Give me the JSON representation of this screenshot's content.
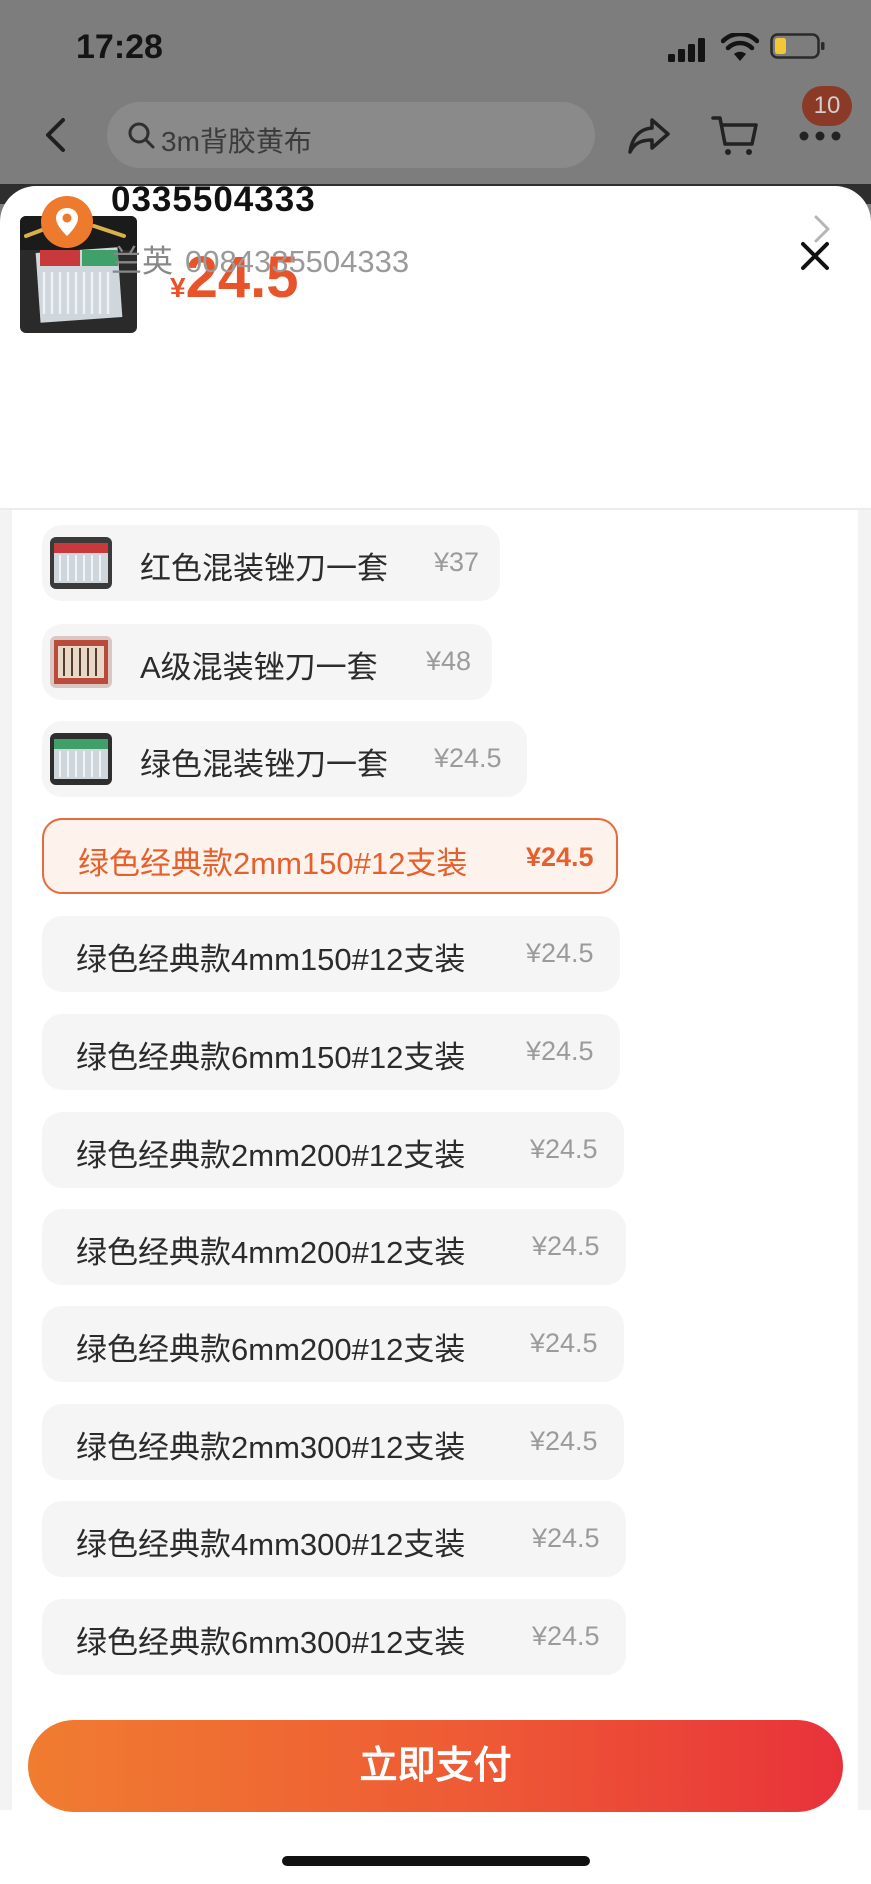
{
  "status_bar": {
    "time": "17:28"
  },
  "nav": {
    "search_placeholder": "3m背胶黄布",
    "cart_badge": "10"
  },
  "product": {
    "currency": "¥",
    "price": "24.5"
  },
  "address": {
    "phone": "0335504333",
    "name": "兰英",
    "detail": "0084335504333"
  },
  "options": [
    {
      "label": "红色混装锉刀一套",
      "price": "¥37",
      "has_image": true,
      "selected": false
    },
    {
      "label": "A级混装锉刀一套",
      "price": "¥48",
      "has_image": true,
      "selected": false
    },
    {
      "label": "绿色混装锉刀一套",
      "price": "¥24.5",
      "has_image": true,
      "selected": false
    },
    {
      "label": "绿色经典款2mm150#12支装",
      "price": "¥24.5",
      "has_image": false,
      "selected": true
    },
    {
      "label": "绿色经典款4mm150#12支装",
      "price": "¥24.5",
      "has_image": false,
      "selected": false
    },
    {
      "label": "绿色经典款6mm150#12支装",
      "price": "¥24.5",
      "has_image": false,
      "selected": false
    },
    {
      "label": "绿色经典款2mm200#12支装",
      "price": "¥24.5",
      "has_image": false,
      "selected": false
    },
    {
      "label": "绿色经典款4mm200#12支装",
      "price": "¥24.5",
      "has_image": false,
      "selected": false
    },
    {
      "label": "绿色经典款6mm200#12支装",
      "price": "¥24.5",
      "has_image": false,
      "selected": false
    },
    {
      "label": "绿色经典款2mm300#12支装",
      "price": "¥24.5",
      "has_image": false,
      "selected": false
    },
    {
      "label": "绿色经典款4mm300#12支装",
      "price": "¥24.5",
      "has_image": false,
      "selected": false
    },
    {
      "label": "绿色经典款6mm300#12支装",
      "price": "¥24.5",
      "has_image": false,
      "selected": false
    }
  ],
  "pay_button": "立即支付",
  "colors": {
    "accent": "#e8532a",
    "selected_bg": "#fdf2ec",
    "option_bg": "#f5f5f5"
  }
}
